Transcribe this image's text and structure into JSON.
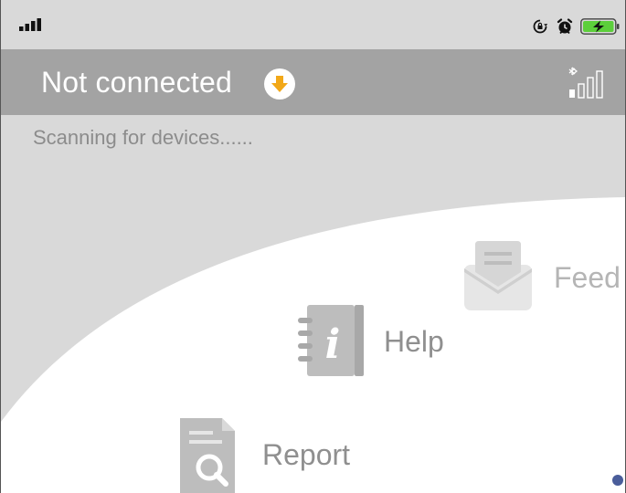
{
  "status_bar": {
    "icons": [
      "cellular-signal-icon",
      "rotation-lock-icon",
      "alarm-icon",
      "battery-charging-icon"
    ],
    "battery_color": "#5ccf3b"
  },
  "header": {
    "title": "Not connected",
    "accent_color": "#f2a818",
    "icons": [
      "connect-arrow-icon",
      "bluetooth-signal-icon"
    ]
  },
  "scan": {
    "status_text": "Scanning for devices......"
  },
  "menu": {
    "items": [
      {
        "label": "Feed",
        "icon": "envelope-icon"
      },
      {
        "label": "Help",
        "icon": "info-notebook-icon"
      },
      {
        "label": "Report",
        "icon": "report-search-icon"
      }
    ]
  },
  "pager": {
    "dot_color": "#4a5d9a"
  }
}
